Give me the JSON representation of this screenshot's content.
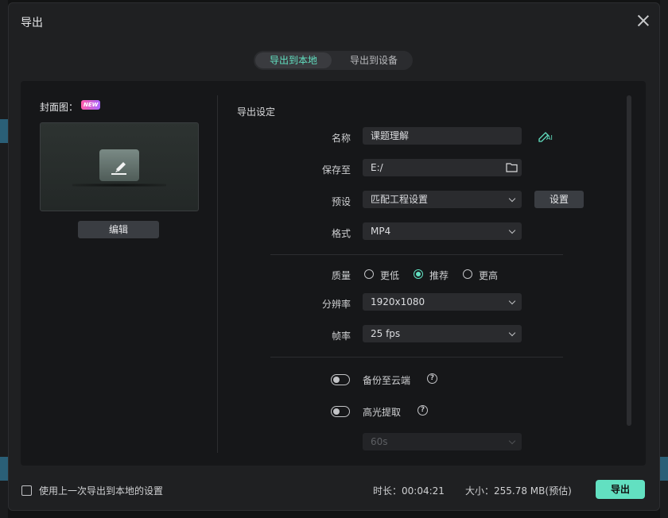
{
  "dialog": {
    "title": "导出"
  },
  "tabs": [
    {
      "label": "导出到本地",
      "active": true
    },
    {
      "label": "导出到设备",
      "active": false
    }
  ],
  "cover": {
    "label": "封面图：",
    "badge": "NEW",
    "edit_label": "编辑"
  },
  "settings": {
    "section_title": "导出设定",
    "name": {
      "label": "名称",
      "value": "课题理解",
      "ai_badge": "AI"
    },
    "save_to": {
      "label": "保存至",
      "value": "E:/"
    },
    "preset": {
      "label": "预设",
      "value": "匹配工程设置",
      "button": "设置"
    },
    "format": {
      "label": "格式",
      "value": "MP4"
    },
    "quality": {
      "label": "质量",
      "options": [
        {
          "label": "更低",
          "checked": false
        },
        {
          "label": "推荐",
          "checked": true
        },
        {
          "label": "更高",
          "checked": false
        }
      ]
    },
    "resolution": {
      "label": "分辨率",
      "value": "1920x1080"
    },
    "framerate": {
      "label": "帧率",
      "value": "25 fps"
    },
    "cloud_backup": {
      "label": "备份至云端",
      "on": false
    },
    "highlight": {
      "label": "高光提取",
      "on": false,
      "duration": "60s"
    }
  },
  "footer": {
    "checkbox_label": "使用上一次导出到本地的设置",
    "duration": "时长：00:04:21",
    "size": "大小：255.78 MB(预估)",
    "export_label": "导出"
  },
  "colors": {
    "accent": "#62e0c1",
    "dialog_bg": "#1f2022",
    "panel_bg": "#161719"
  }
}
